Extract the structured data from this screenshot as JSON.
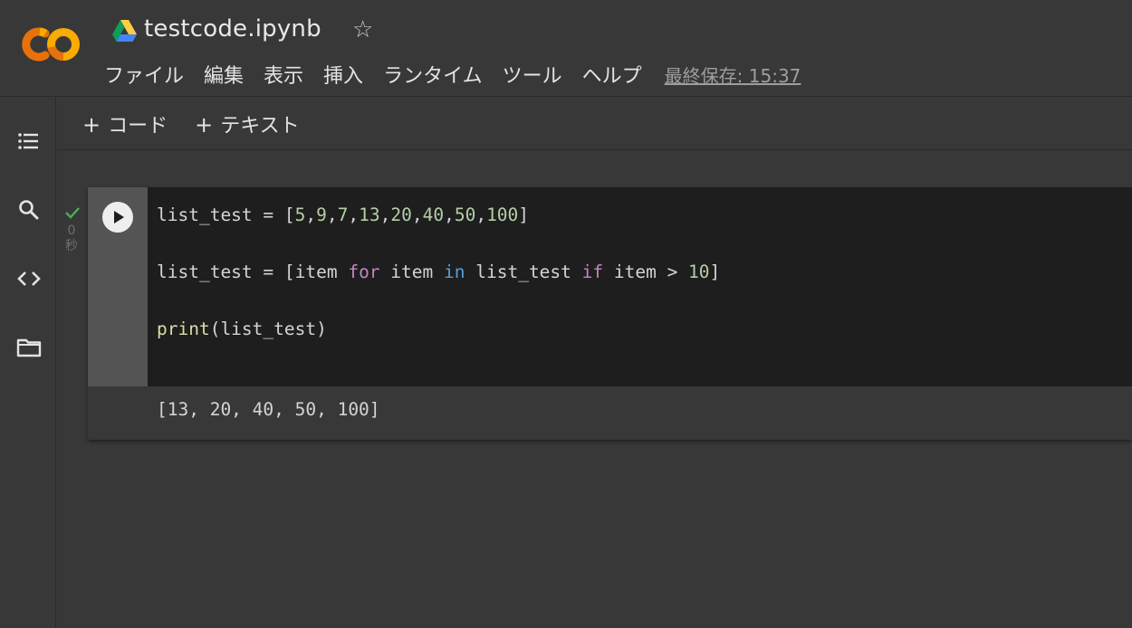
{
  "header": {
    "title": "testcode.ipynb",
    "menu": [
      "ファイル",
      "編集",
      "表示",
      "挿入",
      "ランタイム",
      "ツール",
      "ヘルプ"
    ],
    "last_saved": "最終保存: 15:37"
  },
  "toolbar": {
    "add_code_label": "コード",
    "add_text_label": "テキスト",
    "plus": "+"
  },
  "cell": {
    "exec_time_value": "0",
    "exec_time_unit": "秒",
    "code": {
      "line1": {
        "var": "list_test = [",
        "nums": [
          "5",
          "9",
          "7",
          "13",
          "20",
          "40",
          "50",
          "100"
        ],
        "sep": ",",
        "close": "]"
      },
      "line2": {
        "a": "list_test = [item ",
        "kw_for": "for",
        "b": " item ",
        "kw_in": "in",
        "c": " list_test ",
        "kw_if": "if",
        "d": " item > ",
        "num": "10",
        "e": "]"
      },
      "line3": {
        "fn": "print",
        "rest": "(list_test)"
      }
    },
    "output": "[13, 20, 40, 50, 100]"
  },
  "colors": {
    "background": "#383838",
    "editor": "#1e1e1e",
    "gutter": "#545454",
    "check": "#4caf50",
    "logo_orange": "#f9ab00",
    "logo_dark_orange": "#e8710a"
  }
}
